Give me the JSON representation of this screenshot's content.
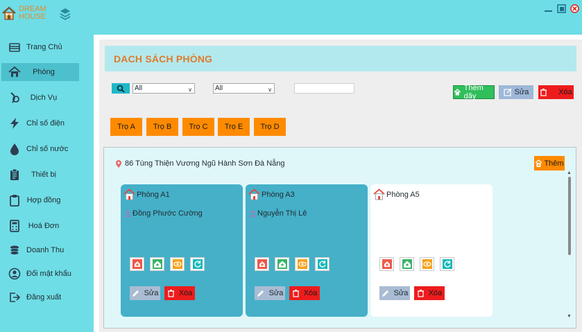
{
  "app": {
    "logo_line1": "DREAM",
    "logo_line2": "HOUSE"
  },
  "colors": {
    "accent_orange": "#ff8a00",
    "sidebar_bg": "#6fdde6",
    "card_occupied": "#45b0c8",
    "delete_red": "#ee1c1c",
    "add_green": "#2fbf5b"
  },
  "sidebar": {
    "items": [
      {
        "label": "Trang Chủ",
        "icon": "home-dashboard-icon"
      },
      {
        "label": "Phòng",
        "icon": "house-icon"
      },
      {
        "label": "Dịch Vụ",
        "icon": "service-icon"
      },
      {
        "label": "Chỉ số điện",
        "icon": "lightning-icon"
      },
      {
        "label": "Chỉ số nước",
        "icon": "water-drop-icon"
      },
      {
        "label": "Thiết bị",
        "icon": "clipboard-icon"
      },
      {
        "label": "Hợp đồng",
        "icon": "contract-icon"
      },
      {
        "label": "Hoá Đơn",
        "icon": "calculator-icon"
      },
      {
        "label": "Doanh Thu",
        "icon": "coins-icon"
      },
      {
        "label": "Đổi mật khẩu",
        "icon": "user-circle-icon"
      },
      {
        "label": "Đăng xuất",
        "icon": "logout-icon"
      }
    ],
    "active_index": 1
  },
  "main": {
    "title": "DACH SÁCH PHÒNG",
    "filter1": "All",
    "filter2": "All",
    "search_value": "",
    "add_block_label": "Thêm dãy",
    "edit_label": "Sửa",
    "delete_label": "Xóa",
    "blocks": [
      "Trọ A",
      "Trọ B",
      "Trọ C",
      "Trọ E",
      "Trọ D"
    ],
    "address": "86 Tùng Thiện Vương Ngũ Hành Sơn Đà Nẵng",
    "add_room_label": "Thêm",
    "rooms": [
      {
        "name": "Phòng A1",
        "tenant": "Đồng Phước Cường",
        "edit": "Sửa",
        "delete": "Xóa"
      },
      {
        "name": "Phòng A3",
        "tenant": "Nguyễn Thị Lê",
        "edit": "Sửa",
        "delete": "Xóa"
      },
      {
        "name": "Phòng A5",
        "tenant": "",
        "edit": "Sửa",
        "delete": "Xóa"
      }
    ]
  }
}
